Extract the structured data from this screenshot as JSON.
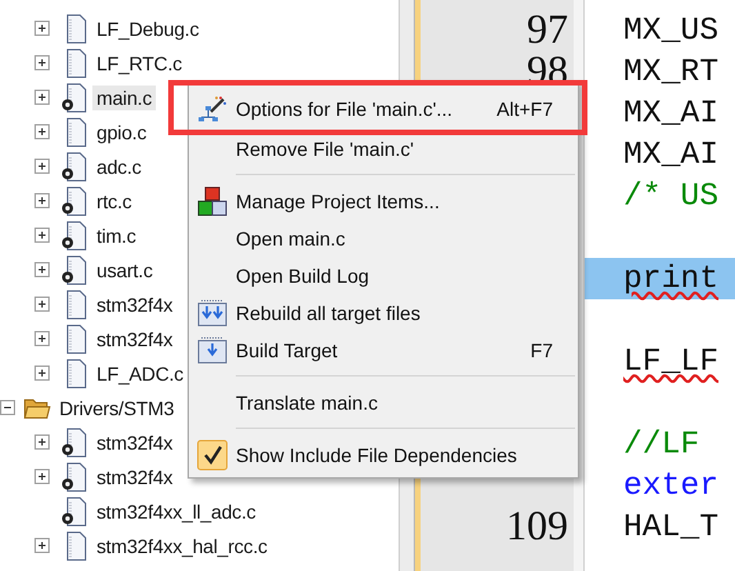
{
  "tree": [
    {
      "children": [
        {
          "label": "LF_Debug.c",
          "expandable": true,
          "gear": false,
          "selected": false
        },
        {
          "label": "LF_RTC.c",
          "expandable": true,
          "gear": false,
          "selected": false
        },
        {
          "label": "main.c",
          "expandable": true,
          "gear": true,
          "selected": true
        },
        {
          "label": "gpio.c",
          "expandable": true,
          "gear": false,
          "selected": false
        },
        {
          "label": "adc.c",
          "expandable": true,
          "gear": true,
          "selected": false
        },
        {
          "label": "rtc.c",
          "expandable": true,
          "gear": true,
          "selected": false
        },
        {
          "label": "tim.c",
          "expandable": true,
          "gear": true,
          "selected": false
        },
        {
          "label": "usart.c",
          "expandable": true,
          "gear": true,
          "selected": false
        },
        {
          "label": "stm32f4x",
          "expandable": true,
          "gear": false,
          "selected": false
        },
        {
          "label": "stm32f4x",
          "expandable": true,
          "gear": false,
          "selected": false
        },
        {
          "label": "LF_ADC.c",
          "expandable": true,
          "gear": false,
          "selected": false
        }
      ]
    },
    {
      "label": "Drivers/STM3",
      "expanded": true,
      "children": [
        {
          "label": "stm32f4x",
          "expandable": true,
          "gear": true,
          "selected": false
        },
        {
          "label": "stm32f4x",
          "expandable": true,
          "gear": true,
          "selected": false
        },
        {
          "label": "stm32f4xx_ll_adc.c",
          "expandable": false,
          "gear": true,
          "selected": false
        },
        {
          "label": "stm32f4xx_hal_rcc.c",
          "expandable": true,
          "gear": false,
          "selected": false
        }
      ]
    }
  ],
  "editor": {
    "lines": [
      {
        "number": "97",
        "text": "MX_US",
        "kind": "plain",
        "squiggle": false,
        "highlighted": false
      },
      {
        "number": "98",
        "text": "MX_RT",
        "kind": "plain",
        "squiggle": false,
        "highlighted": false
      },
      {
        "text": "MX_AI",
        "kind": "plain",
        "squiggle": false,
        "highlighted": false
      },
      {
        "text": "MX_AI",
        "kind": "plain",
        "squiggle": false,
        "highlighted": false
      },
      {
        "text": "/* US",
        "kind": "comment",
        "squiggle": false,
        "highlighted": false
      },
      {
        "kind": "blank"
      },
      {
        "text": "print",
        "kind": "plain",
        "squiggle": true,
        "highlighted": true
      },
      {
        "kind": "blank"
      },
      {
        "text": "LF_LF",
        "kind": "plain",
        "squiggle": true,
        "highlighted": false
      },
      {
        "kind": "blank"
      },
      {
        "text": "//LF",
        "kind": "comment",
        "squiggle": false,
        "highlighted": false
      },
      {
        "text": "exter",
        "kind": "keyword",
        "squiggle": false,
        "highlighted": false
      },
      {
        "number": "109",
        "text": "HAL_T",
        "kind": "plain",
        "squiggle": false,
        "highlighted": false
      }
    ]
  },
  "context_menu": {
    "items": [
      {
        "kind": "item",
        "label": "Options for File 'main.c'...",
        "shortcut": "Alt+F7",
        "boxed": true
      },
      {
        "kind": "item",
        "label": "Remove File 'main.c'",
        "boxed": false
      },
      {
        "kind": "separator"
      },
      {
        "kind": "item",
        "label": "Manage Project Items...",
        "boxed": false
      },
      {
        "kind": "item",
        "label": "Open main.c",
        "boxed": false
      },
      {
        "kind": "item",
        "label": "Open Build Log",
        "boxed": false
      },
      {
        "kind": "item",
        "label": "Rebuild all target files",
        "boxed": false
      },
      {
        "kind": "item",
        "label": "Build Target",
        "shortcut": "F7",
        "boxed": false
      },
      {
        "kind": "separator"
      },
      {
        "kind": "item",
        "label": "Translate main.c",
        "boxed": false
      },
      {
        "kind": "separator"
      },
      {
        "kind": "check",
        "label": "Show Include File Dependencies",
        "checked": true,
        "boxed": false
      }
    ]
  }
}
